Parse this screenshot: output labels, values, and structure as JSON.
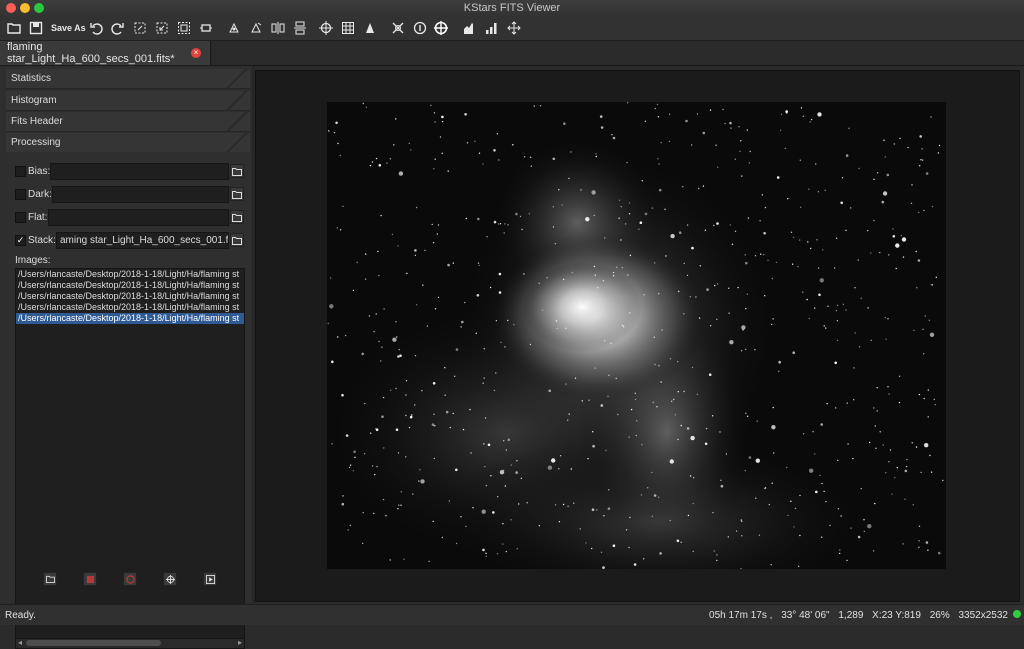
{
  "window": {
    "title": "KStars FITS Viewer"
  },
  "toolbar": {
    "save_as_label": "Save As",
    "icons": [
      "open-icon",
      "save-icon",
      "undo-icon",
      "redo-icon",
      "crop-icon",
      "select-icon",
      "fit-icon",
      "flip-icon",
      "rotate-icon",
      "histogram-icon",
      "star-detect-icon",
      "target-icon",
      "grid-icon",
      "pixel-icon",
      "starbox-icon",
      "info-icon",
      "crosshair-icon",
      "graph-icon",
      "bars-icon",
      "move-icon"
    ]
  },
  "tab": {
    "label": "flaming star_Light_Ha_600_secs_001.fits*"
  },
  "sidebar": {
    "sections": [
      "Statistics",
      "Histogram",
      "Fits Header",
      "Processing"
    ],
    "processing": {
      "bias_label": "Bias:",
      "bias_value": "",
      "dark_label": "Dark:",
      "dark_value": "",
      "flat_label": "Flat:",
      "flat_value": "",
      "stack_label": "Stack:",
      "stack_checked": true,
      "stack_value": "aming star_Light_Ha_600_secs_001.fits",
      "images_label": "Images:",
      "images": [
        "/Users/rlancaste/Desktop/2018-1-18/Light/Ha/flaming st",
        "/Users/rlancaste/Desktop/2018-1-18/Light/Ha/flaming st",
        "/Users/rlancaste/Desktop/2018-1-18/Light/Ha/flaming st",
        "/Users/rlancaste/Desktop/2018-1-18/Light/Ha/flaming st",
        "/Users/rlancaste/Desktop/2018-1-18/Light/Ha/flaming st"
      ],
      "selected_image_index": 4
    }
  },
  "status": {
    "left": "Ready.",
    "ra": "05h 17m 17s ,",
    "dec": "33° 48' 06\"",
    "value": "1,289",
    "coords": "X:23 Y:819",
    "zoom": "26%",
    "size": "3352x2532",
    "led_color": "#2ecc40"
  }
}
